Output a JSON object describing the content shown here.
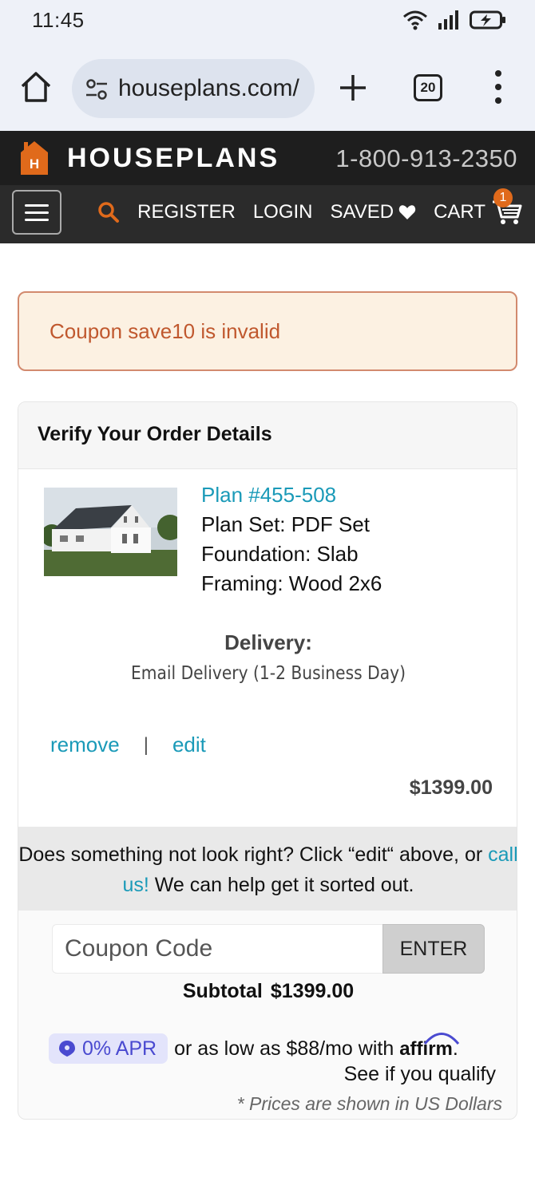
{
  "status_bar": {
    "time": "11:45"
  },
  "browser": {
    "url": "houseplans.com/",
    "tab_count": "20"
  },
  "site": {
    "logo_text": "HOUSEPLANS",
    "logo_letter": "H",
    "phone": "1-800-913-2350",
    "nav": {
      "register": "REGISTER",
      "login": "LOGIN",
      "saved": "SAVED",
      "cart": "CART",
      "cart_count": "1"
    },
    "brand_color": "#e06a1b"
  },
  "alert": {
    "message": "Coupon save10 is invalid"
  },
  "order": {
    "title": "Verify Your Order Details",
    "plan_link": "Plan #455-508",
    "plan_set": "Plan Set: PDF Set",
    "foundation": "Foundation: Slab",
    "framing": "Framing: Wood 2x6",
    "delivery_label": "Delivery:",
    "delivery_value": "Email Delivery (1-2 Business Day)",
    "remove": "remove",
    "separator": "|",
    "edit": "edit",
    "price": "$1399.00"
  },
  "help": {
    "before_link": "Does something not look right?  Click “edit“ above, or ",
    "link": "call us!",
    "after_link": "  We can help get it sorted out."
  },
  "coupon": {
    "placeholder": "Coupon Code",
    "button": "ENTER"
  },
  "subtotal": {
    "label": "Subtotal",
    "value": "$1399.00"
  },
  "financing": {
    "apr_badge": "0% APR",
    "text": "or as low as $88/mo with",
    "brand": "affirm",
    "qualify": "See if you qualify",
    "note": "* Prices are shown in US Dollars"
  }
}
